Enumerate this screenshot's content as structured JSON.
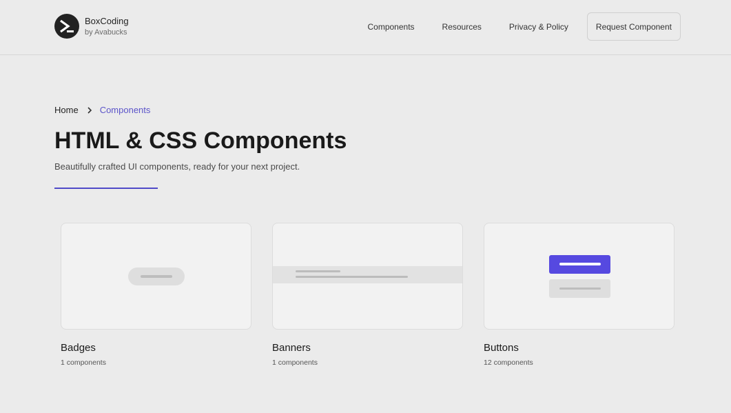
{
  "brand": {
    "title": "BoxCoding",
    "subtitle": "by Avabucks",
    "logo_icon": "prompt-chevron-icon"
  },
  "nav": {
    "links": [
      "Components",
      "Resources",
      "Privacy & Policy"
    ],
    "cta_label": "Request Component"
  },
  "breadcrumb": {
    "home": "Home",
    "separator_icon": "chevron-right-icon",
    "current": "Components"
  },
  "hero": {
    "title": "HTML & CSS Components",
    "subtitle": "Beautifully crafted UI components, ready for your next project."
  },
  "colors": {
    "accent": "#5649e0",
    "breadcrumb_active": "#5b54c9",
    "background": "#ebebeb"
  },
  "cards": [
    {
      "name": "Badges",
      "count": "1 components",
      "preview": "badge-preview"
    },
    {
      "name": "Banners",
      "count": "1 components",
      "preview": "banner-preview"
    },
    {
      "name": "Buttons",
      "count": "12 components",
      "preview": "buttons-preview"
    }
  ]
}
